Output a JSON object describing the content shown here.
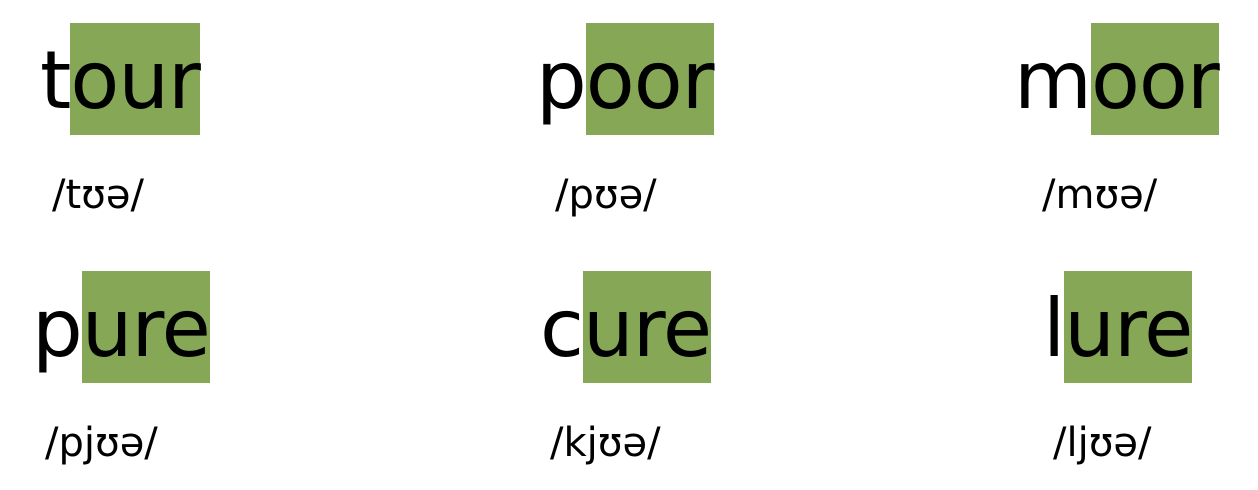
{
  "accent_color": "#86a755",
  "words": [
    {
      "prefix": "t",
      "highlight": "our",
      "ipa": "/tʊə/"
    },
    {
      "prefix": "p",
      "highlight": "oor",
      "ipa": "/pʊə/"
    },
    {
      "prefix": "m",
      "highlight": "oor",
      "ipa": "/mʊə/"
    },
    {
      "prefix": "p",
      "highlight": "ure",
      "ipa": "/pjʊə/"
    },
    {
      "prefix": "c",
      "highlight": "ure",
      "ipa": "/kjʊə/"
    },
    {
      "prefix": "l",
      "highlight": "ure",
      "ipa": "/ljʊə/"
    }
  ]
}
